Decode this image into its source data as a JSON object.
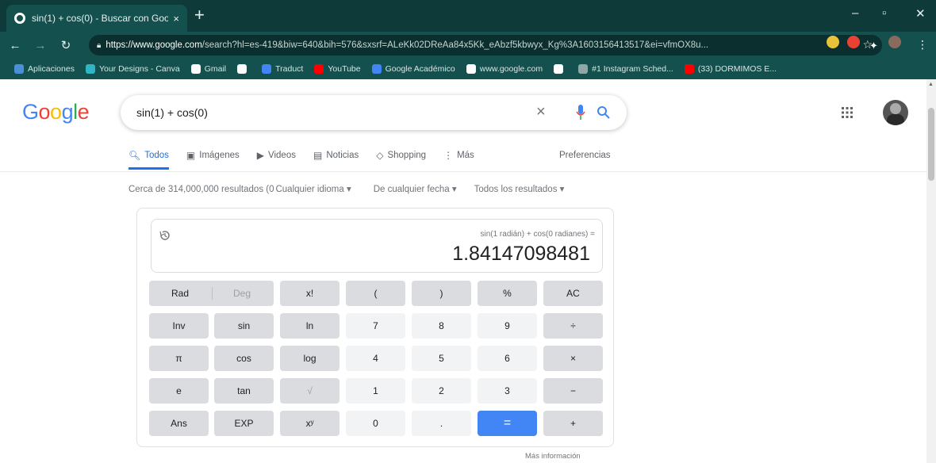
{
  "browser": {
    "tab_title": "sin(1) + cos(0) - Buscar con Goo",
    "tab_close": "×",
    "new_tab": "+",
    "win_min": "–",
    "win_max": "▫",
    "win_close": "✕",
    "url_host": "https://www.google.com",
    "url_path": "/search?hl=es-419&biw=640&bih=576&sxsrf=ALeKk02DReAa84x5Kk_eAbzf5kbwyx_Kg%3A1603156413517&ei=vfmOX8u...",
    "bookmarks": [
      {
        "label": "Aplicaciones",
        "color": "#4a90d9"
      },
      {
        "label": "Your Designs - Canva",
        "color": "#2fb5c4"
      },
      {
        "label": "Gmail",
        "color": "#ffffff"
      },
      {
        "label": "",
        "color": "#ffffff"
      },
      {
        "label": "Traduct",
        "color": "#4285f4"
      },
      {
        "label": "YouTube",
        "color": "#ff0000"
      },
      {
        "label": "Google Académico",
        "color": "#4285f4"
      },
      {
        "label": "www.google.com",
        "color": "#ffffff"
      },
      {
        "label": "",
        "color": "#ffffff"
      },
      {
        "label": "#1 Instagram Sched...",
        "color": "#8fa7a6"
      },
      {
        "label": "(33) DORMIMOS E...",
        "color": "#ff0000"
      }
    ]
  },
  "google": {
    "logo": "Google",
    "query": "sin(1) + cos(0)",
    "tabs": [
      {
        "icon": "search-icon",
        "label": "Todos",
        "active": true
      },
      {
        "icon": "image-icon",
        "label": "Imágenes"
      },
      {
        "icon": "video-icon",
        "label": "Videos"
      },
      {
        "icon": "news-icon",
        "label": "Noticias"
      },
      {
        "icon": "tag-icon",
        "label": "Shopping"
      },
      {
        "icon": "more-icon",
        "label": "Más"
      }
    ],
    "preferences": "Preferencias",
    "stats": "Cerca de 314,000,000 resultados (0",
    "filter_language": "Cualquier idioma ▾",
    "filter_date": "De cualquier fecha ▾",
    "filter_results": "Todos los resultados ▾",
    "more_info": "Más información"
  },
  "calculator": {
    "expression": "sin(1 radián) + cos(0 radianes) =",
    "result": "1.84147098481",
    "rows": [
      [
        {
          "l": "Rad",
          "t": "fn",
          "w": 2
        },
        {
          "l": "Deg",
          "t": "fn dis",
          "w": 0
        },
        {
          "l": "x!",
          "t": "fn"
        },
        {
          "l": "(",
          "t": "fn"
        },
        {
          "l": ")",
          "t": "fn"
        },
        {
          "l": "%",
          "t": "fn"
        },
        {
          "l": "AC",
          "t": "fn"
        }
      ],
      [
        {
          "l": "Inv",
          "t": "fn"
        },
        {
          "l": "sin",
          "t": "fn"
        },
        {
          "l": "ln",
          "t": "fn"
        },
        {
          "l": "7",
          "t": "num"
        },
        {
          "l": "8",
          "t": "num"
        },
        {
          "l": "9",
          "t": "num"
        },
        {
          "l": "÷",
          "t": "fn"
        }
      ],
      [
        {
          "l": "π",
          "t": "fn"
        },
        {
          "l": "cos",
          "t": "fn"
        },
        {
          "l": "log",
          "t": "fn"
        },
        {
          "l": "4",
          "t": "num"
        },
        {
          "l": "5",
          "t": "num"
        },
        {
          "l": "6",
          "t": "num"
        },
        {
          "l": "×",
          "t": "fn"
        }
      ],
      [
        {
          "l": "e",
          "t": "fn"
        },
        {
          "l": "tan",
          "t": "fn"
        },
        {
          "l": "√",
          "t": "fn dis"
        },
        {
          "l": "1",
          "t": "num"
        },
        {
          "l": "2",
          "t": "num"
        },
        {
          "l": "3",
          "t": "num"
        },
        {
          "l": "−",
          "t": "fn"
        }
      ],
      [
        {
          "l": "Ans",
          "t": "fn"
        },
        {
          "l": "EXP",
          "t": "fn"
        },
        {
          "l": "xʸ",
          "t": "fn"
        },
        {
          "l": "0",
          "t": "num"
        },
        {
          "l": ".",
          "t": "num"
        },
        {
          "l": "=",
          "t": "eq"
        },
        {
          "l": "+",
          "t": "fn"
        }
      ]
    ]
  }
}
